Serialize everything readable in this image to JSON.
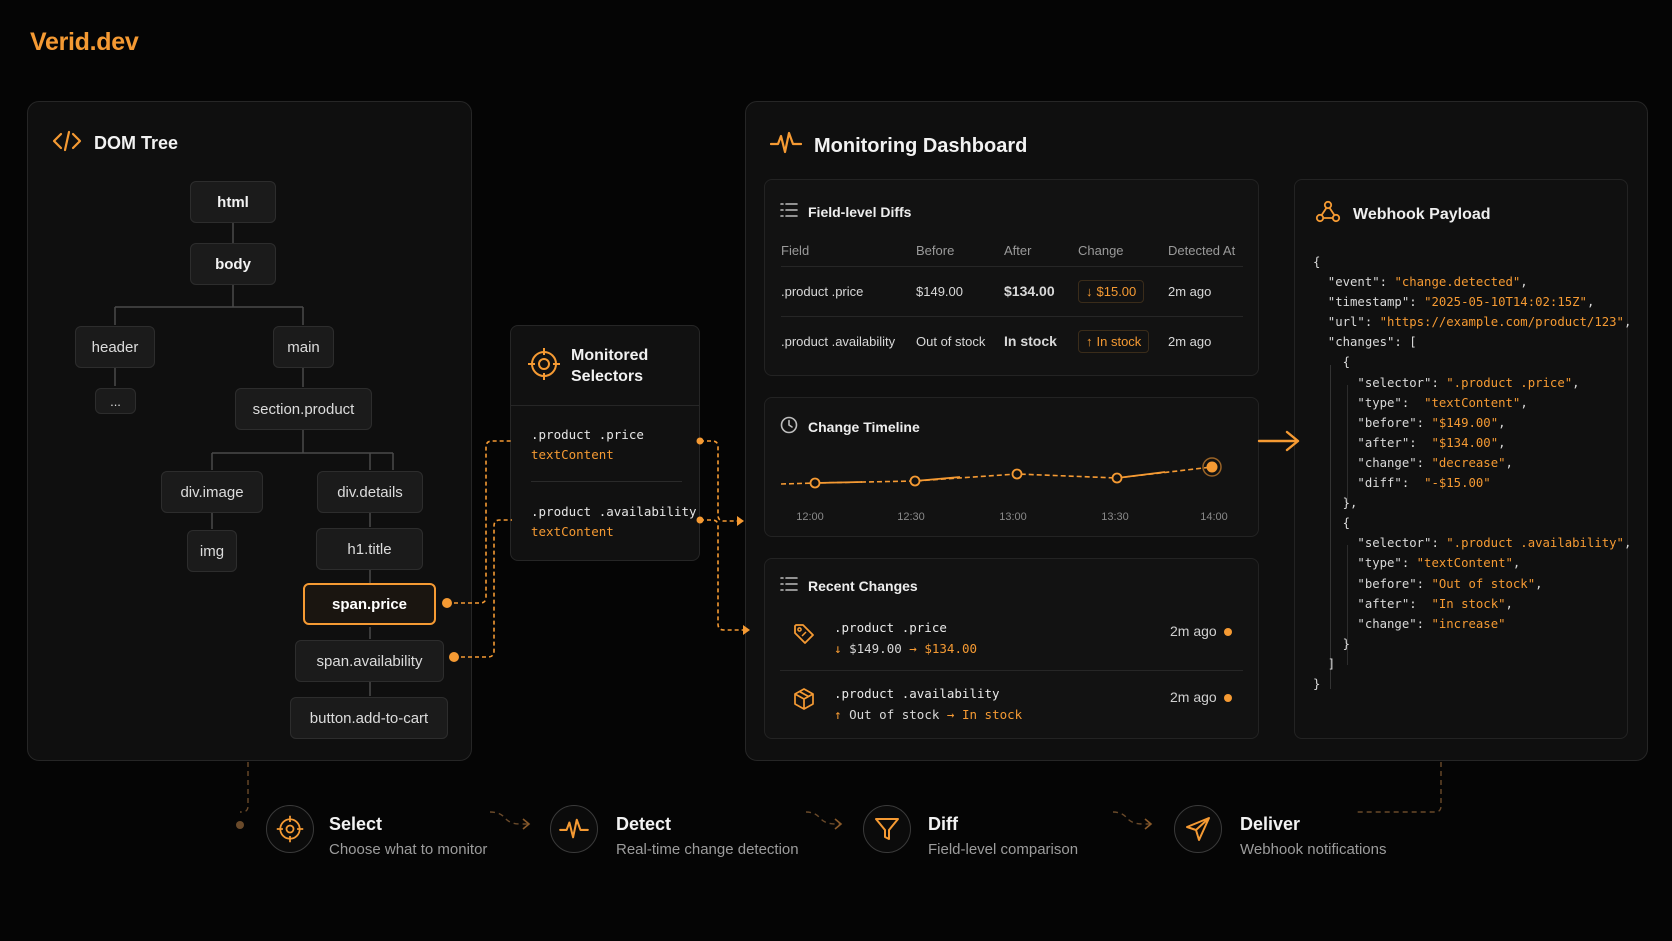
{
  "brand": "Verid.dev",
  "dom_tree": {
    "title": "DOM Tree",
    "icon": "code-icon",
    "nodes": {
      "html": "html",
      "body": "body",
      "header": "header",
      "ellipsis": "...",
      "main": "main",
      "section": "section.product",
      "div_image": "div.image",
      "img": "img",
      "div_details": "div.details",
      "h1": "h1.title",
      "span_price": "span.price",
      "span_availability": "span.availability",
      "button": "button.add-to-cart"
    }
  },
  "monitored": {
    "title_line1": "Monitored",
    "title_line2": "Selectors",
    "icon": "crosshair-icon",
    "items": [
      {
        "selector": ".product .price",
        "type": "textContent"
      },
      {
        "selector": ".product .availability",
        "type": "textContent"
      }
    ]
  },
  "dashboard": {
    "title": "Monitoring Dashboard",
    "icon": "pulse-icon",
    "diffs": {
      "title": "Field-level Diffs",
      "columns": [
        "Field",
        "Before",
        "After",
        "Change",
        "Detected At"
      ],
      "rows": [
        {
          "field": ".product .price",
          "before": "$149.00",
          "after": "$134.00",
          "change_arrow": "↓",
          "change": "$15.00",
          "detected": "2m ago"
        },
        {
          "field": ".product .availability",
          "before": "Out of stock",
          "after": "In stock",
          "change_arrow": "↑",
          "change": "In stock",
          "detected": "2m ago"
        }
      ]
    },
    "timeline": {
      "title": "Change Timeline",
      "icon": "clock-icon",
      "ticks": [
        "12:00",
        "12:30",
        "13:00",
        "13:30",
        "14:00"
      ]
    },
    "recent": {
      "title": "Recent Changes",
      "items": [
        {
          "field": ".product .price",
          "arrow": "↓",
          "before": "$149.00",
          "after": "$134.00",
          "time": "2m ago",
          "icon": "tag-icon"
        },
        {
          "field": ".product .availability",
          "arrow": "↑",
          "before": "Out of stock",
          "after": "In stock",
          "time": "2m ago",
          "icon": "box-icon"
        }
      ]
    }
  },
  "webhook": {
    "title": "Webhook Payload",
    "icon": "webhook-icon"
  },
  "steps": [
    {
      "title": "Select",
      "desc": "Choose what to monitor",
      "icon": "crosshair-icon"
    },
    {
      "title": "Detect",
      "desc": "Real-time change detection",
      "icon": "pulse-icon"
    },
    {
      "title": "Diff",
      "desc": "Field-level comparison",
      "icon": "filter-icon"
    },
    {
      "title": "Deliver",
      "desc": "Webhook notifications",
      "icon": "send-icon"
    }
  ],
  "colors": {
    "accent": "#f59a33",
    "background": "#050505",
    "panel": "#0f0f0f"
  }
}
